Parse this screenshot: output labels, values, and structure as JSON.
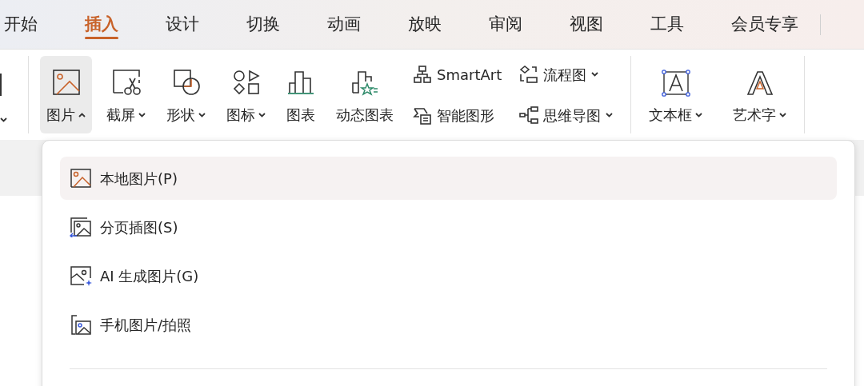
{
  "tabs": [
    {
      "label": "开始",
      "selected": false
    },
    {
      "label": "插入",
      "selected": true
    },
    {
      "label": "设计",
      "selected": false
    },
    {
      "label": "切换",
      "selected": false
    },
    {
      "label": "动画",
      "selected": false
    },
    {
      "label": "放映",
      "selected": false
    },
    {
      "label": "审阅",
      "selected": false
    },
    {
      "label": "视图",
      "selected": false
    },
    {
      "label": "工具",
      "selected": false
    },
    {
      "label": "会员专享",
      "selected": false
    }
  ],
  "ribbon": {
    "groups": [
      {
        "items": [
          {
            "kind": "large",
            "label": "图片",
            "dropdown": true,
            "expanded": true
          },
          {
            "kind": "large",
            "label": "截屏",
            "dropdown": true,
            "expanded": false
          },
          {
            "kind": "large",
            "label": "形状",
            "dropdown": true,
            "expanded": false
          },
          {
            "kind": "large",
            "label": "图标",
            "dropdown": true,
            "expanded": false
          },
          {
            "kind": "large",
            "label": "图表",
            "dropdown": false,
            "expanded": false
          },
          {
            "kind": "large",
            "label": "动态图表",
            "dropdown": false,
            "expanded": false
          },
          {
            "kind": "stack",
            "items": [
              {
                "label": "SmartArt",
                "dropdown": false
              },
              {
                "label": "智能图形",
                "dropdown": false
              }
            ]
          },
          {
            "kind": "stack",
            "items": [
              {
                "label": "流程图",
                "dropdown": true
              },
              {
                "label": "思维导图",
                "dropdown": true
              }
            ]
          }
        ]
      },
      {
        "items": [
          {
            "kind": "large",
            "label": "文本框",
            "dropdown": true,
            "expanded": false
          },
          {
            "kind": "large",
            "label": "艺术字",
            "dropdown": true,
            "expanded": false
          }
        ]
      }
    ]
  },
  "menu": {
    "items": [
      {
        "label": "本地图片(P)",
        "selected": true
      },
      {
        "label": "分页插图(S)",
        "selected": false
      },
      {
        "label": "AI 生成图片(G)",
        "selected": false
      },
      {
        "label": "手机图片/拍照",
        "selected": false
      }
    ]
  }
}
